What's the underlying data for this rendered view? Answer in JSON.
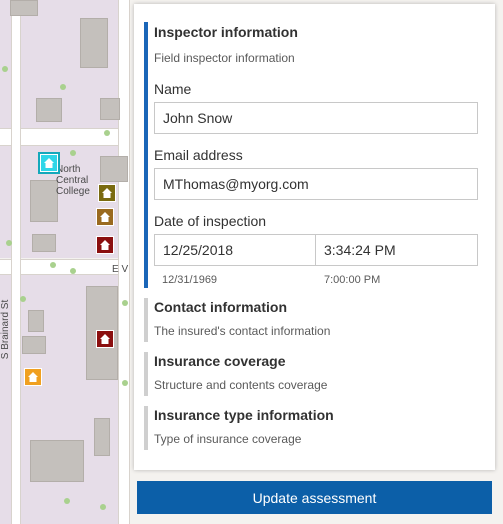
{
  "map": {
    "labels": {
      "college": "North Central College",
      "street_ev": "E V",
      "street_brainard": "S Brainard St"
    },
    "pin_icon": "home-icon",
    "pin_colors": {
      "selected": "#2fd6e8",
      "olive": "#7a6a10",
      "brown": "#9a6a1f",
      "red": "#8b0f0f",
      "orange": "#f0a021"
    }
  },
  "form": {
    "inspector": {
      "title": "Inspector information",
      "description": "Field inspector information",
      "name_label": "Name",
      "name_value": "John Snow",
      "email_label": "Email address",
      "email_value": "MThomas@myorg.com",
      "date_label": "Date of inspection",
      "date_value": "12/25/2018",
      "time_value": "3:34:24 PM",
      "date_hint": "12/31/1969",
      "time_hint": "7:00:00 PM"
    },
    "contact": {
      "title": "Contact information",
      "description": "The insured's contact information"
    },
    "coverage": {
      "title": "Insurance coverage",
      "description": "Structure and contents coverage"
    },
    "type_info": {
      "title": "Insurance type information",
      "description": "Type of insurance coverage"
    },
    "submit_label": "Update assessment"
  },
  "colors": {
    "accent": "#1a66b8",
    "button": "#0c5fa8"
  }
}
